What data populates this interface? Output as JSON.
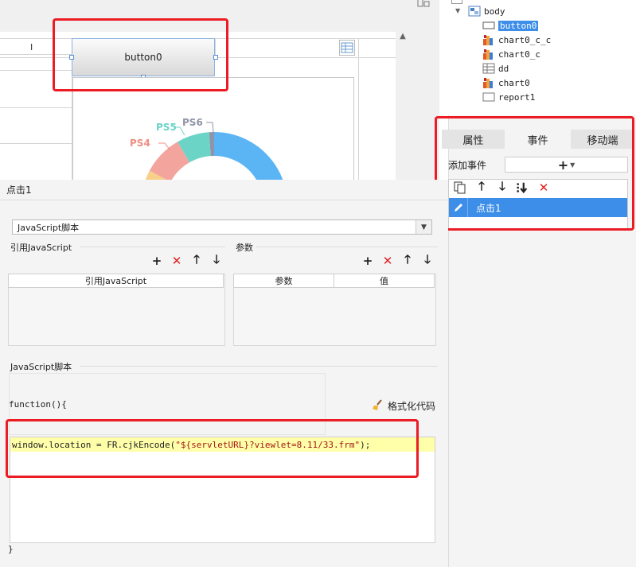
{
  "canvas": {
    "column_header": "I",
    "button_label": "button0"
  },
  "chart": {
    "series_labels": [
      {
        "name": "PS6",
        "color": "#8f95a8"
      },
      {
        "name": "PS5",
        "color": "#6cd4c7"
      },
      {
        "name": "PS4",
        "color": "#f08e82"
      }
    ],
    "ring_colors": [
      "#5bb5f5",
      "#8f95a8",
      "#6cd4c7",
      "#f3a59d",
      "#f7d08a"
    ]
  },
  "tree": {
    "items": [
      {
        "label": "body",
        "icon": "body-icon"
      },
      {
        "label": "button0",
        "icon": "button-icon"
      },
      {
        "label": "chart0_c_c",
        "icon": "chart-icon"
      },
      {
        "label": "chart0_c",
        "icon": "chart-icon"
      },
      {
        "label": "dd",
        "icon": "table-icon"
      },
      {
        "label": "chart0",
        "icon": "chart-icon"
      },
      {
        "label": "report1",
        "icon": "report-icon"
      }
    ]
  },
  "right_panel": {
    "tabs": [
      "属性",
      "事件",
      "移动端"
    ],
    "active_tab": "事件",
    "add_event_label": "添加事件",
    "add_event_button": "+",
    "event_item": "点击1"
  },
  "editor": {
    "event_title": "点击1",
    "script_type": "JavaScript脚本",
    "ref_js_label": "引用JavaScript",
    "params_label": "参数",
    "ref_js_column": "引用JavaScript",
    "param_col_name": "参数",
    "param_col_value": "值",
    "script_section_label": "JavaScript脚本",
    "code_open": "function(){",
    "code_body_prefix": "window.location = FR.cjkEncode(",
    "code_body_string": "\"${servletURL}?viewlet=8.11/33.frm\"",
    "code_body_suffix": ");",
    "code_close": "}",
    "format_button": "格式化代码"
  },
  "colors": {
    "highlight_red": "#ec1c24",
    "selection_blue": "#3d8ee8",
    "code_highlight": "#ffffaa"
  }
}
